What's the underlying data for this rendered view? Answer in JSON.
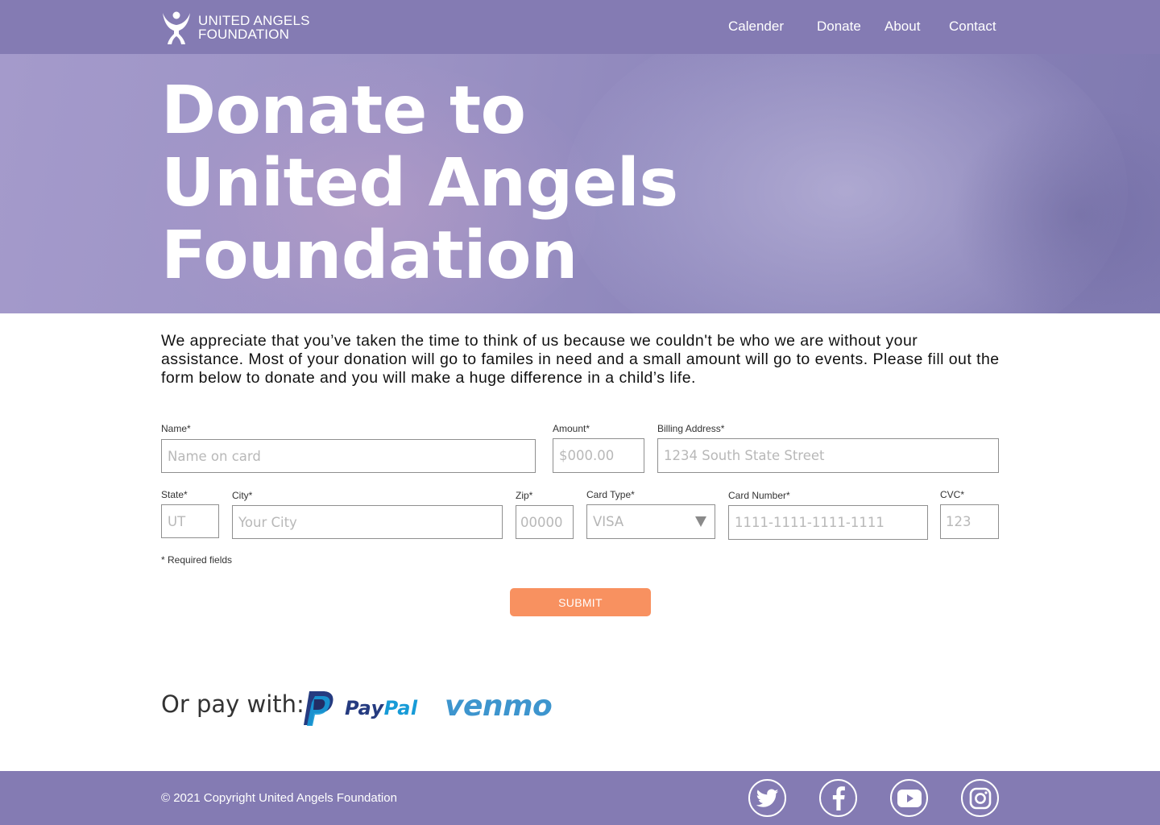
{
  "header": {
    "logo": {
      "line1": "UNITED ANGELS",
      "line2": "FOUNDATION"
    },
    "nav": [
      {
        "label": "Calender"
      },
      {
        "label": "Donate"
      },
      {
        "label": "About"
      },
      {
        "label": "Contact"
      }
    ]
  },
  "hero": {
    "title_lines": [
      "Donate to",
      "United Angels",
      "Foundation"
    ]
  },
  "intro": "We appreciate that you’ve taken the time to think of us because we couldn't be who we are without your assistance. Most of your donation will go to familes in need and a small amount will go to events. Please fill out the form below to donate and you will make a huge difference in a child’s life.",
  "form": {
    "name": {
      "label": "Name*",
      "placeholder": "Name on card",
      "value": ""
    },
    "amount": {
      "label": "Amount*",
      "placeholder": "$000.00",
      "value": ""
    },
    "billing": {
      "label": "Billing Address*",
      "placeholder": "1234 South State Street",
      "value": ""
    },
    "state": {
      "label": "State*",
      "placeholder": "UT",
      "value": ""
    },
    "city": {
      "label": "City*",
      "placeholder": "Your City",
      "value": ""
    },
    "zip": {
      "label": "Zip*",
      "placeholder": "00000",
      "value": ""
    },
    "card_type": {
      "label": "Card Type*",
      "selected": "VISA"
    },
    "card_number": {
      "label": "Card Number*",
      "placeholder": "1111-1111-1111-1111",
      "value": ""
    },
    "cvc": {
      "label": "CVC*",
      "placeholder": "123",
      "value": ""
    },
    "required_note": "* Required fields",
    "submit_label": "SUBMIT"
  },
  "alt_pay": {
    "label": "Or pay with:",
    "paypal_pay": "Pay",
    "paypal_pal": "Pal",
    "venmo": "venmo"
  },
  "footer": {
    "copyright": "© 2021 Copyright United Angels Foundation",
    "social": [
      "twitter-icon",
      "facebook-icon",
      "youtube-icon",
      "instagram-icon"
    ]
  },
  "colors": {
    "brand_purple": "#847bb3",
    "submit_orange": "#f89160",
    "paypal_dark": "#253b80",
    "paypal_light": "#179bd7",
    "venmo_blue": "#3d95ce"
  }
}
